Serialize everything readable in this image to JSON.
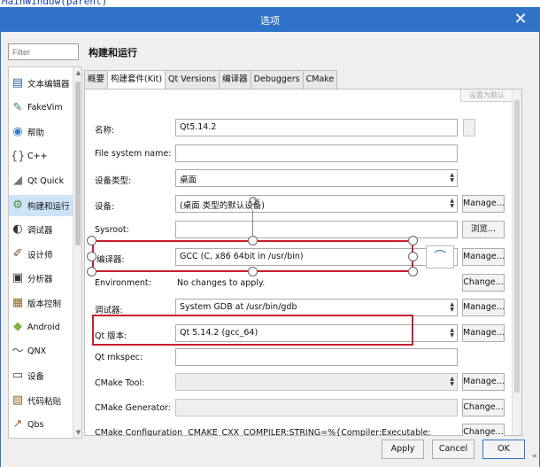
{
  "background_code": "MainWindow(parent)",
  "window": {
    "title": "选项",
    "close_glyph": "✕"
  },
  "sidebar": {
    "filter_placeholder": "Filter",
    "items": [
      {
        "label": "文本编辑器",
        "icon": "text-editor-icon",
        "glyph": "▤",
        "color": "#3a5f9a"
      },
      {
        "label": "FakeVim",
        "icon": "fakevim-icon",
        "glyph": "✎",
        "color": "#2e8b57"
      },
      {
        "label": "帮助",
        "icon": "help-icon",
        "glyph": "◉",
        "color": "#3f7ac7"
      },
      {
        "label": "C++",
        "icon": "cpp-icon",
        "glyph": "{}",
        "color": "#555555"
      },
      {
        "label": "Qt Quick",
        "icon": "qtquick-icon",
        "glyph": "◢",
        "color": "#777777"
      },
      {
        "label": "构建和运行",
        "icon": "build-run-icon",
        "glyph": "⚙",
        "color": "#4a8f3a"
      },
      {
        "label": "调试器",
        "icon": "debugger-icon",
        "glyph": "◐",
        "color": "#333333"
      },
      {
        "label": "设计师",
        "icon": "designer-icon",
        "glyph": "✐",
        "color": "#8a4a2a"
      },
      {
        "label": "分析器",
        "icon": "analyzer-icon",
        "glyph": "▣",
        "color": "#333333"
      },
      {
        "label": "版本控制",
        "icon": "version-control-icon",
        "glyph": "▦",
        "color": "#8a6a2a"
      },
      {
        "label": "Android",
        "icon": "android-icon",
        "glyph": "◆",
        "color": "#7cb342"
      },
      {
        "label": "QNX",
        "icon": "qnx-icon",
        "glyph": "〜",
        "color": "#555555"
      },
      {
        "label": "设备",
        "icon": "devices-icon",
        "glyph": "▭",
        "color": "#444444"
      },
      {
        "label": "代码粘贴",
        "icon": "code-paste-icon",
        "glyph": "▧",
        "color": "#8a6a2a"
      },
      {
        "label": "Qbs",
        "icon": "qbs-icon",
        "glyph": "↗",
        "color": "#a05a2a"
      }
    ],
    "selected_index": 5
  },
  "page": {
    "title": "构建和运行",
    "tabs": [
      "概要",
      "构建套件(Kit)",
      "Qt Versions",
      "编译器",
      "Debuggers",
      "CMake"
    ],
    "active_tab": 1,
    "restore_default": "设置为默认"
  },
  "form": {
    "name": {
      "label": "名称:",
      "value": "Qt5.14.2"
    },
    "fs_name": {
      "label": "File system name:",
      "value": ""
    },
    "device_type": {
      "label": "设备类型:",
      "value": "桌面"
    },
    "device": {
      "label": "设备:",
      "value": "(桌面 类型的默认设备)",
      "button": "Manage..."
    },
    "sysroot": {
      "label": "Sysroot:",
      "value": "",
      "button": "浏览..."
    },
    "compiler": {
      "label": "编译器:",
      "value": "GCC (C, x86 64bit in /usr/bin)",
      "button": "Manage..."
    },
    "environment": {
      "label": "Environment:",
      "value": "No changes to apply.",
      "button": "Change..."
    },
    "debugger": {
      "label": "调试器:",
      "value": "System GDB at /usr/bin/gdb",
      "button": "Manage..."
    },
    "qt_version": {
      "label": "Qt 版本:",
      "value": "Qt 5.14.2 (gcc_64)",
      "button": "Manage..."
    },
    "qt_mkspec": {
      "label": "Qt mkspec:",
      "value": ""
    },
    "cmake_tool": {
      "label": "CMake Tool:",
      "value": "",
      "button": "Manage..."
    },
    "cmake_generator": {
      "label": "CMake Generator:",
      "value": "",
      "button": "Change..."
    },
    "cmake_config": {
      "label": "CMake Configuration",
      "value": "CMAKE_CXX_COMPILER:STRING=%{Compiler:Executable:Cxx} QT_QMAKE",
      "button": "Change..."
    }
  },
  "footer": {
    "apply": "Apply",
    "cancel": "Cancel",
    "ok": "OK"
  },
  "colors": {
    "titlebar": "#2f72c8",
    "highlight": "#c9202b",
    "selected": "#cde3f7"
  }
}
